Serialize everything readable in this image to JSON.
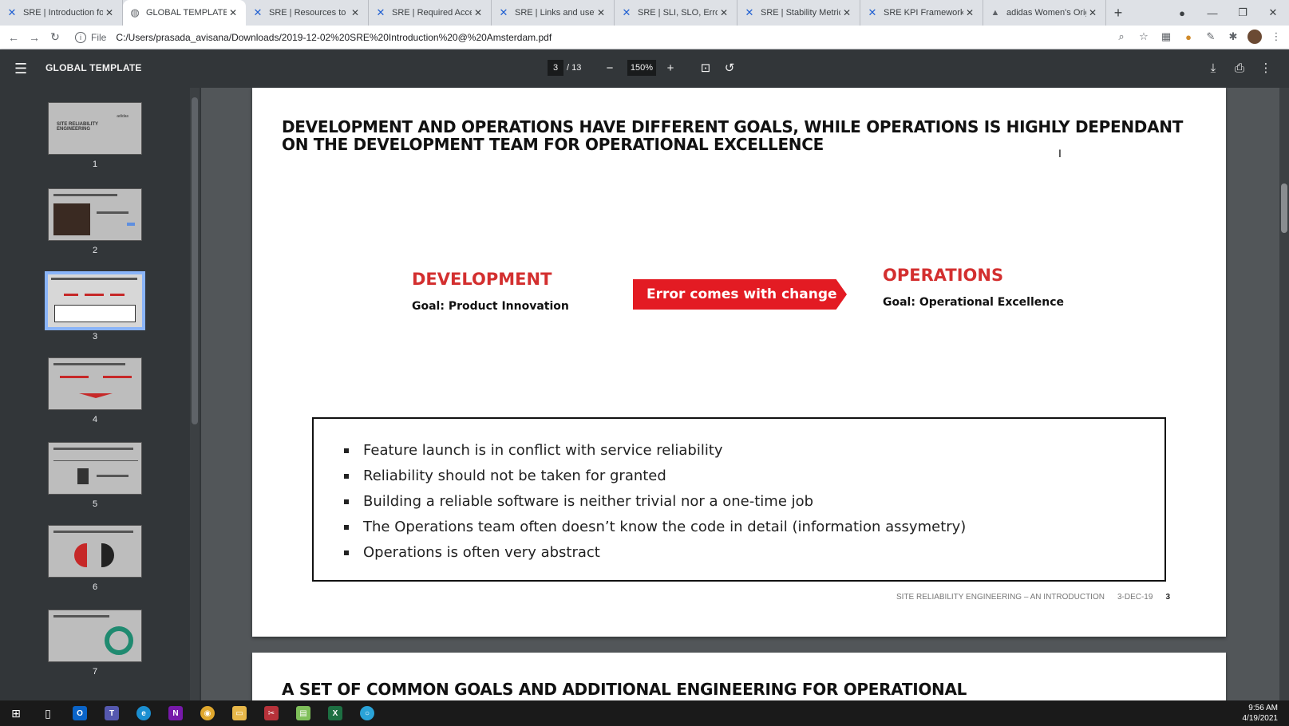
{
  "browser": {
    "tabs": [
      {
        "title": "SRE | Introduction for",
        "icon": "confluence-icon",
        "active": false
      },
      {
        "title": "GLOBAL TEMPLATE",
        "icon": "globe-icon",
        "active": true
      },
      {
        "title": "SRE | Resources to und",
        "icon": "confluence-icon",
        "active": false
      },
      {
        "title": "SRE | Required Access",
        "icon": "confluence-icon",
        "active": false
      },
      {
        "title": "SRE | Links and useful",
        "icon": "confluence-icon",
        "active": false
      },
      {
        "title": "SRE | SLI, SLO, Error B",
        "icon": "confluence-icon",
        "active": false
      },
      {
        "title": "SRE | Stability Metrics",
        "icon": "confluence-icon",
        "active": false
      },
      {
        "title": "SRE KPI Framework - E",
        "icon": "confluence-icon",
        "active": false
      },
      {
        "title": "adidas Women's Origi",
        "icon": "drive-icon",
        "active": false
      }
    ],
    "address": {
      "scheme_label": "File",
      "url": "C:/Users/prasada_avisana/Downloads/2019-12-02%20SRE%20Introduction%20@%20Amsterdam.pdf"
    }
  },
  "pdf": {
    "title": "GLOBAL TEMPLATE",
    "current_page": "3",
    "total_pages": "/ 13",
    "zoom": "150%",
    "thumbnails": [
      "1",
      "2",
      "3",
      "4",
      "5",
      "6",
      "7"
    ],
    "thumb1_text": "SITE RELIABILITY ENGINEERING",
    "thumb1_logo": "adidas"
  },
  "slide": {
    "heading": "DEVELOPMENT AND OPERATIONS HAVE DIFFERENT GOALS, WHILE OPERATIONS IS HIGHLY DEPENDANT ON THE DEVELOPMENT TEAM FOR OPERATIONAL EXCELLENCE",
    "development": {
      "title": "DEVELOPMENT",
      "goal": "Goal: Product Innovation"
    },
    "arrow_label": "Error comes with change",
    "operations": {
      "title": "OPERATIONS",
      "goal": "Goal: Operational Excellence"
    },
    "bullets": [
      "Feature launch is in conflict with service reliability",
      "Reliability should not be taken for granted",
      "Building a reliable software is neither trivial nor a one-time job",
      "The Operations team often doesn’t know the code in detail (information assymetry)",
      "Operations is often very abstract"
    ],
    "footer": {
      "label": "SITE RELIABILITY ENGINEERING – AN INTRODUCTION",
      "date": "3-DEC-19",
      "page": "3"
    }
  },
  "next_slide": {
    "heading": "A SET OF COMMON GOALS AND ADDITIONAL ENGINEERING FOR OPERATIONAL"
  },
  "taskbar": {
    "time": "9:56 AM",
    "date": "4/19/2021"
  },
  "colors": {
    "accent_red": "#e31b23",
    "title_red": "#d32f2f",
    "thumb_highlight": "#8ab4f8"
  }
}
